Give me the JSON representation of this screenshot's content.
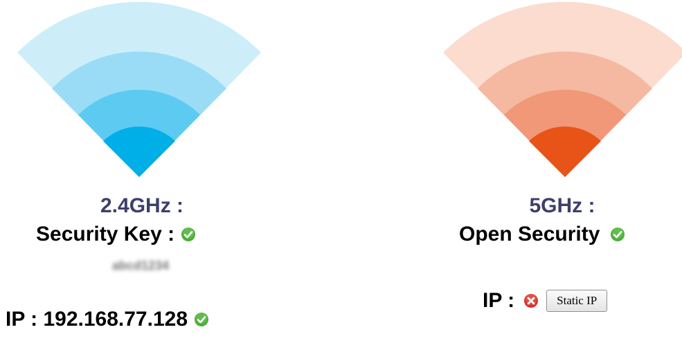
{
  "band_24": {
    "title": "2.4GHz :",
    "security_label": "Security Key :",
    "security_status_icon": "check-circle-icon",
    "security_key_value": "abcd1234",
    "ip_label": "IP : 192.168.77.128",
    "ip_status_icon": "check-circle-icon",
    "colors": [
      "#00aee8",
      "#5dcaf1",
      "#9adcf6",
      "#cdeef9"
    ]
  },
  "band_5": {
    "title": "5GHz :",
    "security_label": "Open Security",
    "security_status_icon": "check-circle-icon",
    "ip_label": "IP :",
    "ip_status_icon": "error-x-icon",
    "static_ip_button": "Static IP",
    "colors": [
      "#e85318",
      "#f09878",
      "#f5b8a0",
      "#fbdccf"
    ]
  },
  "colors": {
    "title_text": "#3c3f6b",
    "ok_green": "#4cae3a",
    "error_red": "#d9322b"
  }
}
